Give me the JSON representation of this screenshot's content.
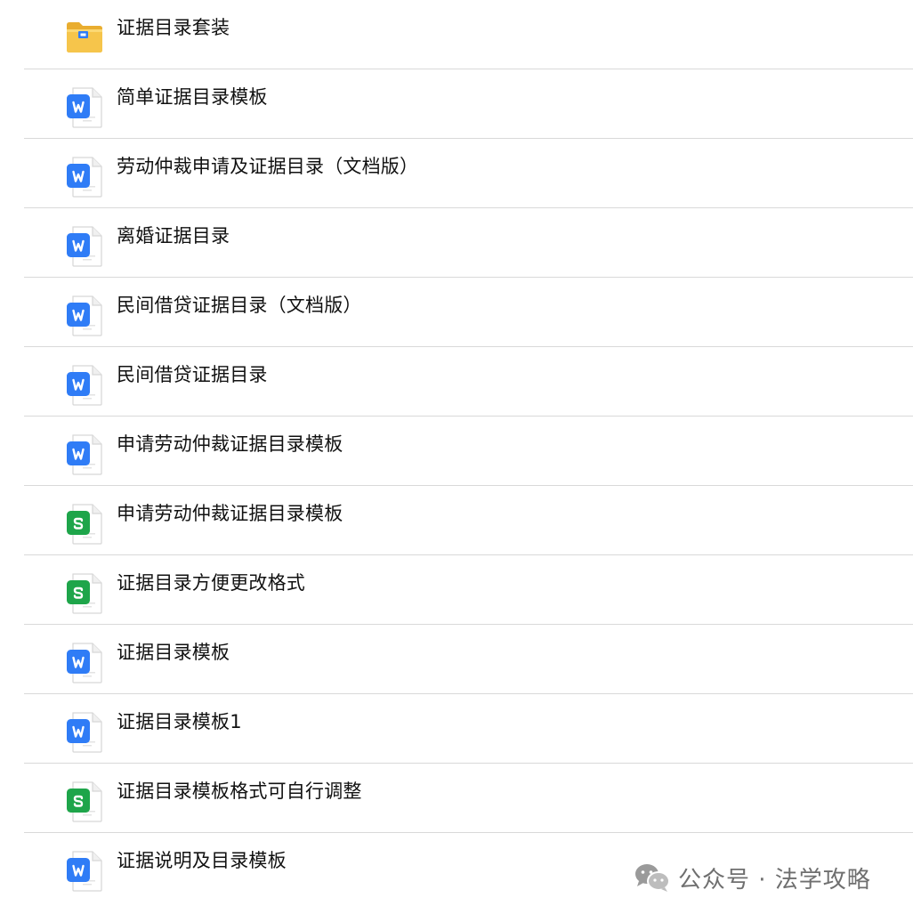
{
  "files": [
    {
      "name": "证据目录套装",
      "type": "folder",
      "icon": "folder-icon"
    },
    {
      "name": "简单证据目录模板",
      "type": "word",
      "icon": "word-doc-icon"
    },
    {
      "name": "劳动仲裁申请及证据目录（文档版）",
      "type": "word",
      "icon": "word-doc-icon"
    },
    {
      "name": "离婚证据目录",
      "type": "word",
      "icon": "word-doc-icon"
    },
    {
      "name": "民间借贷证据目录（文档版）",
      "type": "word",
      "icon": "word-doc-icon"
    },
    {
      "name": "民间借贷证据目录",
      "type": "word",
      "icon": "word-doc-icon"
    },
    {
      "name": "申请劳动仲裁证据目录模板",
      "type": "word",
      "icon": "word-doc-icon"
    },
    {
      "name": "申请劳动仲裁证据目录模板",
      "type": "sheet",
      "icon": "spreadsheet-icon"
    },
    {
      "name": "证据目录方便更改格式",
      "type": "sheet",
      "icon": "spreadsheet-icon"
    },
    {
      "name": "证据目录模板",
      "type": "word",
      "icon": "word-doc-icon"
    },
    {
      "name": "证据目录模板1",
      "type": "word",
      "icon": "word-doc-icon"
    },
    {
      "name": "证据目录模板格式可自行调整",
      "type": "sheet",
      "icon": "spreadsheet-icon"
    },
    {
      "name": "证据说明及目录模板",
      "type": "word",
      "icon": "word-doc-icon"
    }
  ],
  "watermark": {
    "text": "公众号 · 法学攻略",
    "icon": "wechat-icon"
  },
  "colors": {
    "word": "#2f7cf6",
    "sheet": "#1ea54a",
    "folder": "#f6c54b",
    "divider": "#d9d9d9",
    "text": "#111111",
    "watermark": "#6f6f6f"
  }
}
